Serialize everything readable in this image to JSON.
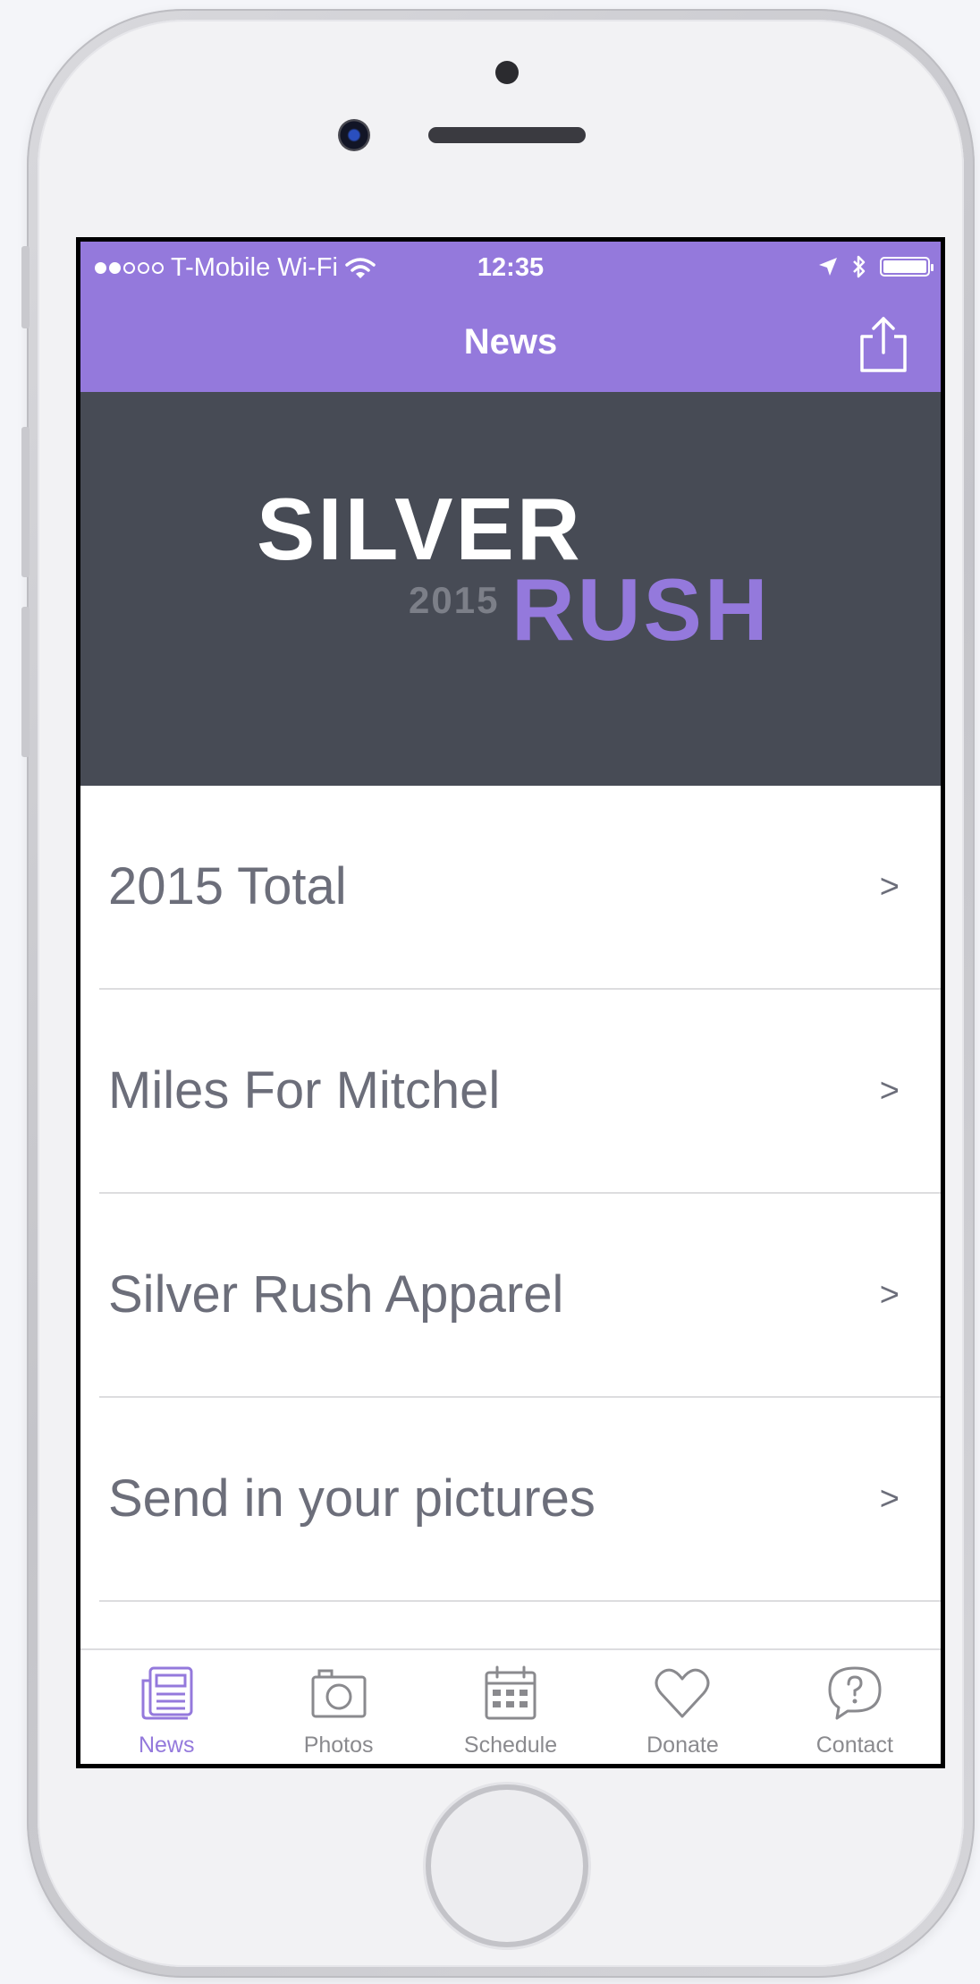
{
  "status_bar": {
    "carrier": "T-Mobile Wi-Fi",
    "time": "12:35"
  },
  "nav": {
    "title": "News"
  },
  "banner": {
    "logo_top": "SILVER",
    "logo_year": "2015",
    "logo_bottom": "RUSH"
  },
  "list": {
    "items": [
      {
        "label": "2015 Total",
        "chevron": ">"
      },
      {
        "label": "Miles For Mitchel",
        "chevron": ">"
      },
      {
        "label": "Silver Rush Apparel",
        "chevron": ">"
      },
      {
        "label": "Send in your pictures",
        "chevron": ">"
      }
    ]
  },
  "tabs": [
    {
      "label": "News",
      "icon": "newspaper-icon",
      "active": true
    },
    {
      "label": "Photos",
      "icon": "camera-icon",
      "active": false
    },
    {
      "label": "Schedule",
      "icon": "calendar-icon",
      "active": false
    },
    {
      "label": "Donate",
      "icon": "heart-icon",
      "active": false
    },
    {
      "label": "Contact",
      "icon": "question-bubble-icon",
      "active": false
    }
  ],
  "colors": {
    "accent": "#9479dc",
    "banner_bg": "#474b55",
    "list_text": "#6c6e7a",
    "tab_inactive": "#8a8a8e"
  }
}
